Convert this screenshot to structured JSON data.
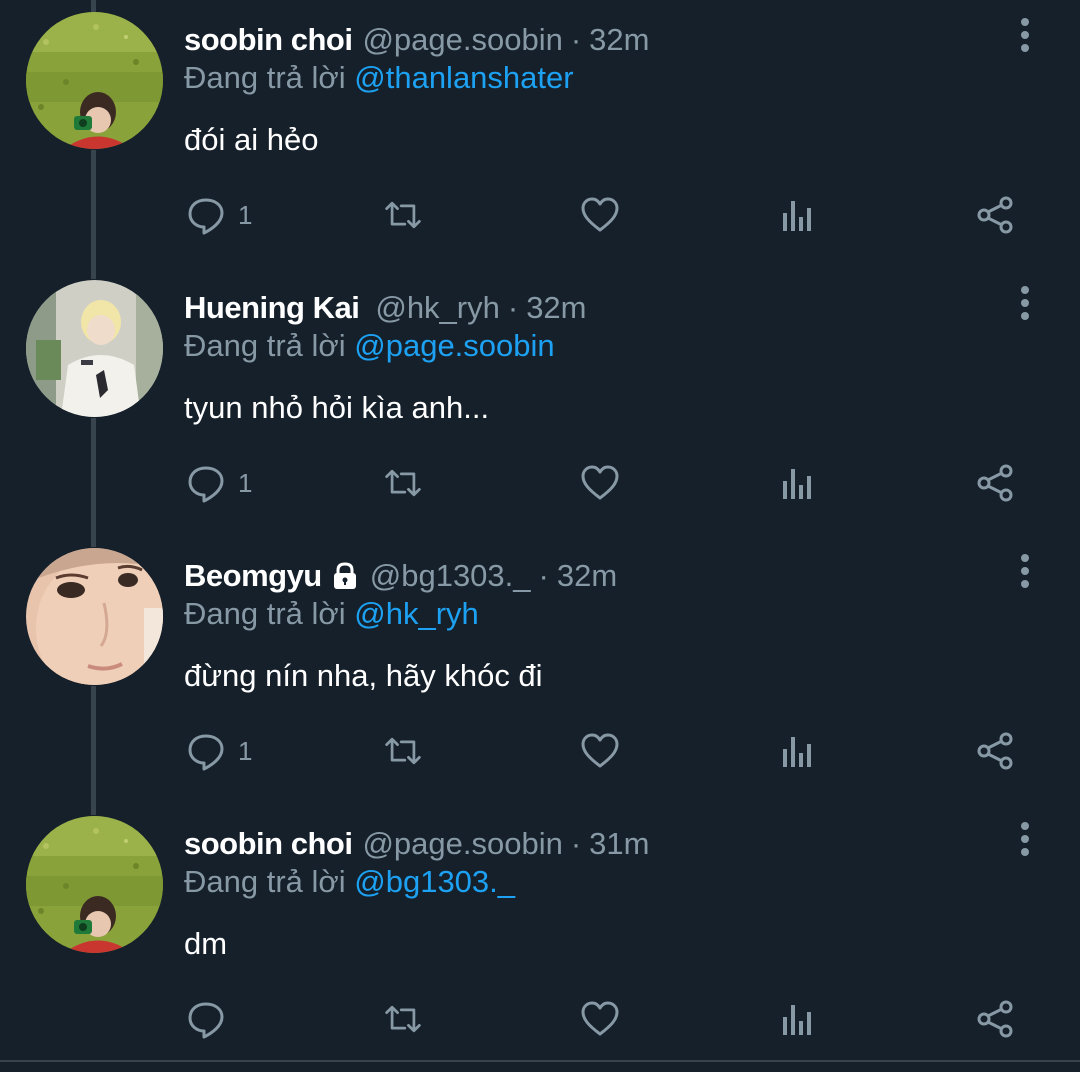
{
  "reply_label": "Đang trả lời",
  "tweets": [
    {
      "name": "soobin choi",
      "handle": "@page.soobin",
      "separator": "·",
      "time": "32m",
      "reply_to": "@thanlanshater",
      "text": "đói ai hẻo",
      "reply_count": "1",
      "locked": false
    },
    {
      "name": "Huening Kai",
      "handle": "@hk_ryh",
      "separator": "·",
      "time": "32m",
      "reply_to": "@page.soobin",
      "text": "tyun nhỏ hỏi kìa anh...",
      "reply_count": "1",
      "locked": false
    },
    {
      "name": "Beomgyu",
      "handle": "@bg1303._",
      "separator": "·",
      "time": "32m",
      "reply_to": "@hk_ryh",
      "text": "đừng nín nha, hãy khóc đi",
      "reply_count": "1",
      "locked": true
    },
    {
      "name": "soobin choi",
      "handle": "@page.soobin",
      "separator": "·",
      "time": "31m",
      "reply_to": "@bg1303._",
      "text": "dm",
      "reply_count": "",
      "locked": false
    }
  ],
  "colors": {
    "background": "#15202b",
    "secondary_text": "#8899a6",
    "link": "#1da1f2",
    "thread_line": "#38444d"
  },
  "icons": [
    "reply-icon",
    "retweet-icon",
    "like-icon",
    "analytics-icon",
    "share-icon",
    "more-options-icon",
    "lock-icon"
  ]
}
